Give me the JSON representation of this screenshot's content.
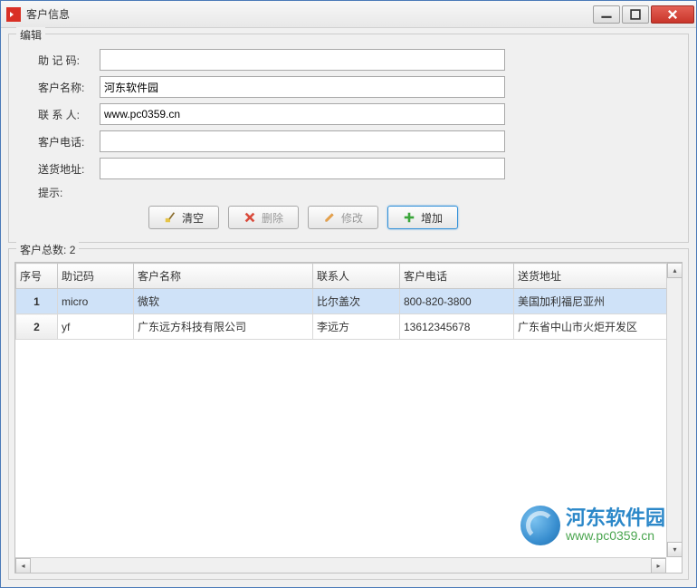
{
  "window": {
    "title": "客户信息"
  },
  "edit_group": {
    "title": "编辑",
    "labels": {
      "mnemonic": "助 记 码:",
      "name": "客户名称:",
      "contact": "联 系 人:",
      "phone": "客户电话:",
      "address": "送货地址:",
      "hint": "提示:"
    },
    "values": {
      "mnemonic": "",
      "name": "河东软件园",
      "contact": "www.pc0359.cn",
      "phone": "",
      "address": ""
    },
    "buttons": {
      "clear": "清空",
      "delete": "删除",
      "modify": "修改",
      "add": "增加"
    }
  },
  "list_group": {
    "title_label": "客户总数:",
    "count": "2",
    "columns": {
      "rownum": "序号",
      "mnemonic": "助记码",
      "name": "客户名称",
      "contact": "联系人",
      "phone": "客户电话",
      "address": "送货地址"
    },
    "rows": [
      {
        "rownum": "1",
        "mnemonic": "micro",
        "name": "微软",
        "contact": "比尔盖次",
        "phone": "800-820-3800",
        "address": "美国加利福尼亚州"
      },
      {
        "rownum": "2",
        "mnemonic": "yf",
        "name": "广东远方科技有限公司",
        "contact": "李远方",
        "phone": "13612345678",
        "address": "广东省中山市火炬开发区"
      }
    ]
  },
  "watermark": {
    "text": "河东软件园",
    "url": "www.pc0359.cn"
  }
}
